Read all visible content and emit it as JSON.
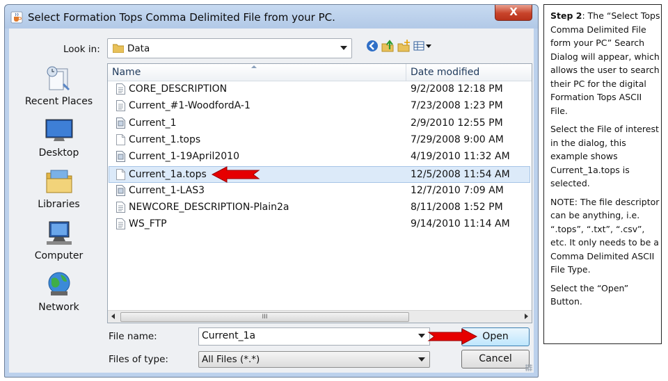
{
  "dialog": {
    "title": "Select Formation Tops Comma Delimited File from your PC.",
    "close_label": "X",
    "look_in_label": "Look in:",
    "look_in_value": "Data",
    "toolbar": [
      "back-icon",
      "up-folder-icon",
      "new-folder-icon",
      "view-menu-icon"
    ],
    "places": [
      {
        "label": "Recent Places",
        "icon": "recent-places-icon"
      },
      {
        "label": "Desktop",
        "icon": "desktop-icon"
      },
      {
        "label": "Libraries",
        "icon": "libraries-icon"
      },
      {
        "label": "Computer",
        "icon": "computer-icon"
      },
      {
        "label": "Network",
        "icon": "network-icon"
      }
    ],
    "columns": {
      "name": "Name",
      "date": "Date modified"
    },
    "files": [
      {
        "name": "CORE_DESCRIPTION",
        "date": "9/2/2008 12:18 PM",
        "icon": "text-file-icon"
      },
      {
        "name": "Current_#1-WoodfordA-1",
        "date": "7/23/2008 1:23 PM",
        "icon": "text-file-icon"
      },
      {
        "name": "Current_1",
        "date": "2/9/2010 12:55 PM",
        "icon": "file-icon"
      },
      {
        "name": "Current_1.tops",
        "date": "7/29/2008 9:00 AM",
        "icon": "blank-file-icon"
      },
      {
        "name": "Current_1-19April2010",
        "date": "4/19/2010 11:32 AM",
        "icon": "file-icon"
      },
      {
        "name": "Current_1a.tops",
        "date": "12/5/2008 11:54 AM",
        "icon": "blank-file-icon",
        "selected": true
      },
      {
        "name": "Current_1-LAS3",
        "date": "12/7/2010 7:09 AM",
        "icon": "file-icon"
      },
      {
        "name": "NEWCORE_DESCRIPTION-Plain2a",
        "date": "8/11/2008 1:52 PM",
        "icon": "text-file-icon"
      },
      {
        "name": "WS_FTP",
        "date": "9/14/2010 11:14 AM",
        "icon": "text-file-icon"
      }
    ],
    "scroll_thumb_label": "III",
    "file_name_label": "File name:",
    "file_name_value": "Current_1a",
    "files_of_type_label": "Files of type:",
    "files_of_type_value": "All Files (*.*)",
    "open_label": "Open",
    "cancel_label": "Cancel"
  },
  "annotation": {
    "step_bold": "Step 2",
    "step_text": ": The “Select Tops Comma Delimited File form your PC” Search Dialog will appear, which allows the user to search their PC for the digital Formation Tops ASCII File.",
    "para2": "Select the File of interest in the dialog, this example shows Current_1a.tops is selected.",
    "para3": "NOTE: The file descriptor can be anything, i.e. “.tops”, “.txt”, “.csv”, etc. It only needs to be a Comma Delimited ASCII File Type.",
    "para4": "Select the “Open” Button."
  },
  "colors": {
    "arrow": "#e60000",
    "selection": "#dceaf9",
    "titlebar": "#bcd1ec"
  }
}
